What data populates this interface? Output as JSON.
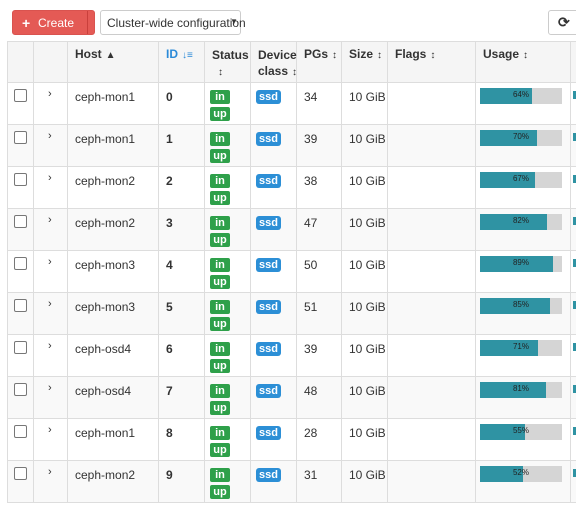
{
  "toolbar": {
    "create_label": "Create",
    "cluster_config_label": "Cluster-wide configuration"
  },
  "colors": {
    "create_button": "#e45a55",
    "badge_green": "#2ea04a",
    "badge_blue": "#2c8fd6",
    "usage_fill": "#2f93a3",
    "usage_track": "#d5d5d5"
  },
  "columns": {
    "host": "Host",
    "id": "ID",
    "status": "Status",
    "device_class_line1": "Device",
    "device_class_line2": "class",
    "pgs": "PGs",
    "size": "Size",
    "flags": "Flags",
    "usage": "Usage"
  },
  "rows": [
    {
      "host": "ceph-mon1",
      "id": "0",
      "status_in": "in",
      "status_up": "up",
      "device_class": "ssd",
      "pgs": "34",
      "size": "10 GiB",
      "flags": "",
      "usage_pct": 64,
      "usage_label": "64%"
    },
    {
      "host": "ceph-mon1",
      "id": "1",
      "status_in": "in",
      "status_up": "up",
      "device_class": "ssd",
      "pgs": "39",
      "size": "10 GiB",
      "flags": "",
      "usage_pct": 70,
      "usage_label": "70%"
    },
    {
      "host": "ceph-mon2",
      "id": "2",
      "status_in": "in",
      "status_up": "up",
      "device_class": "ssd",
      "pgs": "38",
      "size": "10 GiB",
      "flags": "",
      "usage_pct": 67,
      "usage_label": "67%"
    },
    {
      "host": "ceph-mon2",
      "id": "3",
      "status_in": "in",
      "status_up": "up",
      "device_class": "ssd",
      "pgs": "47",
      "size": "10 GiB",
      "flags": "",
      "usage_pct": 82,
      "usage_label": "82%"
    },
    {
      "host": "ceph-mon3",
      "id": "4",
      "status_in": "in",
      "status_up": "up",
      "device_class": "ssd",
      "pgs": "50",
      "size": "10 GiB",
      "flags": "",
      "usage_pct": 89,
      "usage_label": "89%"
    },
    {
      "host": "ceph-mon3",
      "id": "5",
      "status_in": "in",
      "status_up": "up",
      "device_class": "ssd",
      "pgs": "51",
      "size": "10 GiB",
      "flags": "",
      "usage_pct": 85,
      "usage_label": "85%"
    },
    {
      "host": "ceph-osd4",
      "id": "6",
      "status_in": "in",
      "status_up": "up",
      "device_class": "ssd",
      "pgs": "39",
      "size": "10 GiB",
      "flags": "",
      "usage_pct": 71,
      "usage_label": "71%"
    },
    {
      "host": "ceph-osd4",
      "id": "7",
      "status_in": "in",
      "status_up": "up",
      "device_class": "ssd",
      "pgs": "48",
      "size": "10 GiB",
      "flags": "",
      "usage_pct": 81,
      "usage_label": "81%"
    },
    {
      "host": "ceph-mon1",
      "id": "8",
      "status_in": "in",
      "status_up": "up",
      "device_class": "ssd",
      "pgs": "28",
      "size": "10 GiB",
      "flags": "",
      "usage_pct": 55,
      "usage_label": "55%"
    },
    {
      "host": "ceph-mon2",
      "id": "9",
      "status_in": "in",
      "status_up": "up",
      "device_class": "ssd",
      "pgs": "31",
      "size": "10 GiB",
      "flags": "",
      "usage_pct": 52,
      "usage_label": "52%"
    }
  ]
}
